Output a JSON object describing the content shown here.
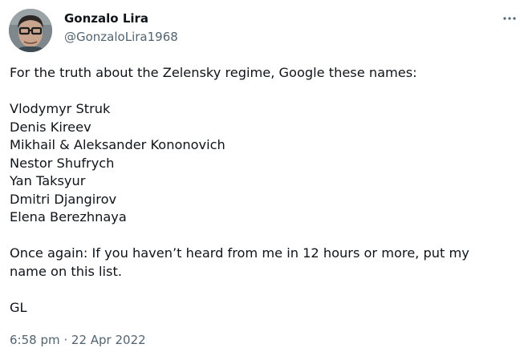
{
  "author": {
    "display_name": "Gonzalo Lira",
    "handle": "@GonzaloLira1968",
    "avatar_icon": "profile-photo"
  },
  "menu": {
    "icon": "more-options-icon"
  },
  "tweet": {
    "intro": "For the truth about the Zelensky regime, Google these names:",
    "names": [
      "Vlodymyr Struk",
      "Denis Kireev",
      "Mikhail & Aleksander Kononovich",
      "Nestor Shufrych",
      "Yan Taksyur",
      "Dmitri Djangirov",
      "Elena Berezhnaya"
    ],
    "outro": "Once again: If you haven’t heard from me in 12 hours or more, put my name on this list.",
    "signoff": "GL"
  },
  "meta": {
    "time": "6:58 pm",
    "separator": " · ",
    "date": "22 Apr 2022"
  },
  "colors": {
    "text": "#0f1419",
    "secondary": "#536471",
    "background": "#ffffff"
  }
}
